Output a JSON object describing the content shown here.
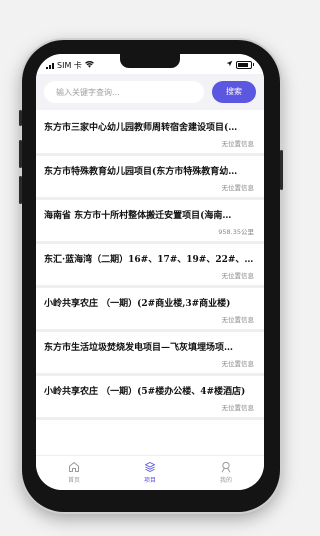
{
  "status": {
    "carrier": "SIM 卡",
    "battery_level": 0.8
  },
  "search": {
    "placeholder": "输入关键字查询...",
    "button_label": "搜索"
  },
  "items": [
    {
      "title": "东方市三家中心幼儿园教师周转宿舍建设项目(…",
      "sub": "无位置信息"
    },
    {
      "title": "东方市特殊教育幼儿园项目(东方市特殊教育幼…",
      "sub": "无位置信息"
    },
    {
      "title": "海南省 东方市十所村整体搬迁安置项目(海南…",
      "sub": "958.35公里"
    },
    {
      "title": "东汇·蓝海湾（二期）16#、17#、19#、22#、23…",
      "sub": "无位置信息"
    },
    {
      "title": "小岭共享农庄 （一期）(2#商业楼,3#商业楼)",
      "sub": "无位置信息"
    },
    {
      "title": "东方市生活垃圾焚烧发电项目—飞灰填埋场项…",
      "sub": "无位置信息"
    },
    {
      "title": "小岭共享农庄 （一期）(5#楼办公楼、4#楼酒店)",
      "sub": "无位置信息"
    }
  ],
  "tabs": [
    {
      "label": "首页",
      "icon": "home-icon"
    },
    {
      "label": "项目",
      "icon": "layers-icon"
    },
    {
      "label": "我的",
      "icon": "user-icon"
    }
  ],
  "colors": {
    "accent": "#5b57e0",
    "background": "#f2f2f2",
    "phone_frame": "#141414"
  }
}
